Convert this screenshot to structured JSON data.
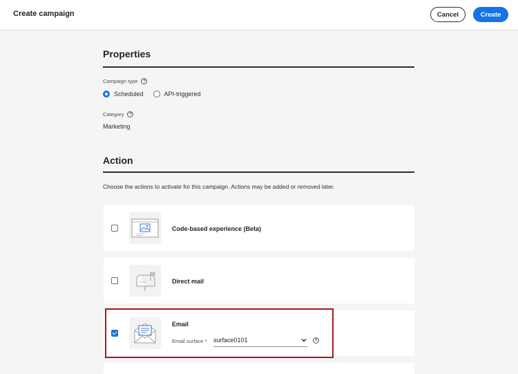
{
  "header": {
    "title": "Create campaign",
    "cancel_label": "Cancel",
    "create_label": "Create"
  },
  "properties": {
    "title": "Properties",
    "campaign_type_label": "Campaign type",
    "options": [
      {
        "label": "Scheduled",
        "selected": true
      },
      {
        "label": "API-triggered",
        "selected": false
      }
    ],
    "category_label": "Category",
    "category_value": "Marketing"
  },
  "action": {
    "title": "Action",
    "description": "Choose the actions to activate for this campaign. Actions may be added or removed later.",
    "cards": [
      {
        "title": "Code-based experience (Beta)",
        "checked": false,
        "icon": "code-based-experience-icon"
      },
      {
        "title": "Direct mail",
        "checked": false,
        "icon": "mailbox-icon"
      },
      {
        "title": "Email",
        "checked": true,
        "icon": "envelope-icon",
        "surface_label": "Email surface",
        "surface_required": "*",
        "surface_value": "surface0101"
      }
    ]
  },
  "colors": {
    "accent": "#1473e6",
    "highlight": "#a3191b"
  }
}
